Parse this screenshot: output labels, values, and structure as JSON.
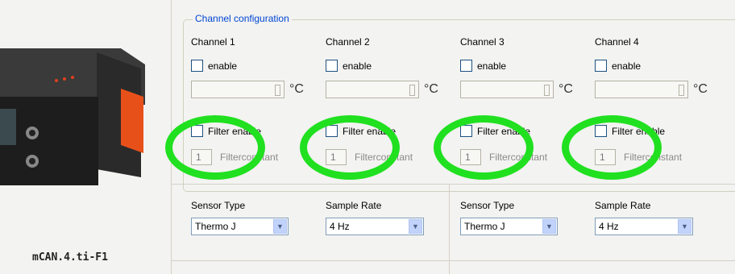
{
  "device": {
    "name": "mCAN.4.ti-F1"
  },
  "config": {
    "group_title": "Channel configuration",
    "unit": "°C",
    "enable_label": "enable",
    "filter_label": "Filter enable",
    "filterconstant_label": "Filterconstant",
    "channels": [
      {
        "label": "Channel 1",
        "filter_value": "1"
      },
      {
        "label": "Channel 2",
        "filter_value": "1"
      },
      {
        "label": "Channel 3",
        "filter_value": "1"
      },
      {
        "label": "Channel 4",
        "filter_value": "1"
      }
    ]
  },
  "sensors": {
    "sensor_type_label": "Sensor Type",
    "sample_rate_label": "Sample Rate",
    "groups": [
      {
        "sensor_type": "Thermo J",
        "sample_rate": "4 Hz"
      },
      {
        "sensor_type": "Thermo J",
        "sample_rate": "4 Hz"
      }
    ]
  },
  "colors": {
    "title_blue": "#0046d5",
    "highlight_green": "#20e020"
  }
}
